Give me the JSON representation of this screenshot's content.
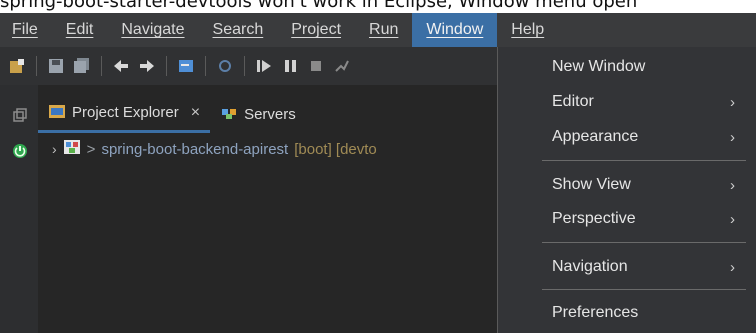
{
  "caption": {
    "text": "spring-boot-starter-devtools won't work in Eclipse, Window menu open"
  },
  "menubar": {
    "items": [
      {
        "label": "File"
      },
      {
        "label": "Edit"
      },
      {
        "label": "Navigate"
      },
      {
        "label": "Search"
      },
      {
        "label": "Project"
      },
      {
        "label": "Run"
      },
      {
        "label": "Window",
        "active": true
      },
      {
        "label": "Help"
      }
    ]
  },
  "toolbar": {
    "icons": [
      "new-icon",
      "save-icon",
      "save-all-icon",
      "back-icon",
      "forward-icon",
      "terminal-icon",
      "link-icon",
      "resume-icon",
      "suspend-icon",
      "stop-icon",
      "disconnect-icon"
    ]
  },
  "views": {
    "tabs": [
      {
        "label": "Project Explorer",
        "active": true,
        "close": "×"
      },
      {
        "label": "Servers",
        "active": false
      }
    ]
  },
  "tree": {
    "project_prefix": ">",
    "project_name": "spring-boot-backend-apirest",
    "project_tags": "[boot] [devto"
  },
  "window_menu": {
    "items": [
      {
        "label": "New Window",
        "submenu": false
      },
      {
        "label": "Editor",
        "submenu": true
      },
      {
        "label": "Appearance",
        "submenu": true
      },
      {
        "label": "Show View",
        "submenu": true
      },
      {
        "label": "Perspective",
        "submenu": true
      },
      {
        "label": "Navigation",
        "submenu": true
      },
      {
        "label": "Preferences",
        "submenu": false
      }
    ],
    "submenu_glyph": "›"
  },
  "colors": {
    "accent": "#3b6fa5",
    "background": "#262626",
    "menubar": "#3a3b3d"
  }
}
